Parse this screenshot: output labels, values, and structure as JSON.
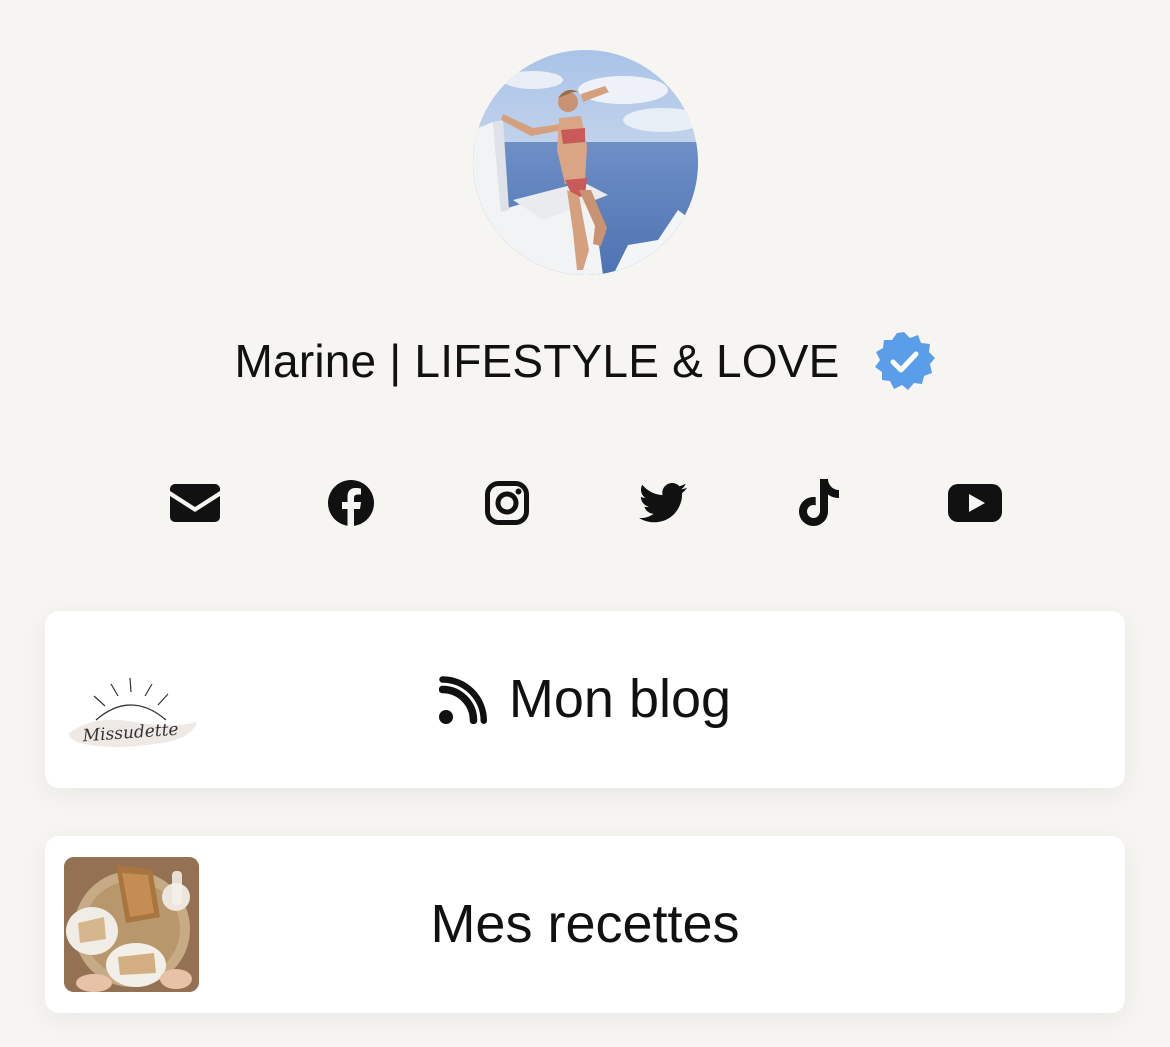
{
  "profile": {
    "name": "Marine | LIFESTYLE & LOVE",
    "verified_badge_color": "#5a9eea"
  },
  "social_icons": [
    "mail-icon",
    "facebook-icon",
    "instagram-icon",
    "twitter-icon",
    "tiktok-icon",
    "youtube-icon"
  ],
  "links": [
    {
      "label": "Mon blog",
      "icon": "rss-icon",
      "thumbnail_text": "Missudette"
    },
    {
      "label": "Mes recettes"
    }
  ],
  "colors": {
    "background": "#f7f5f2",
    "card": "#ffffff",
    "text": "#111111"
  }
}
